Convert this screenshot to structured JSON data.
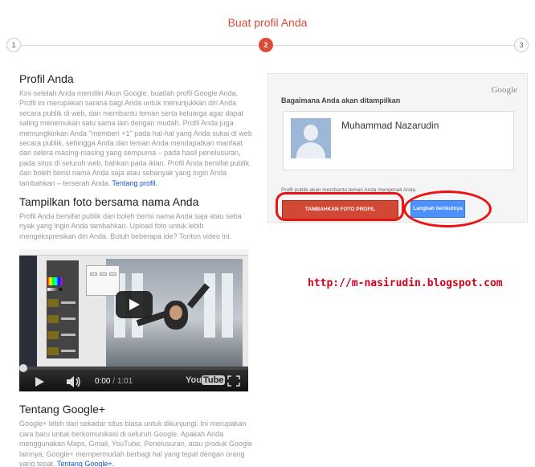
{
  "header": {
    "title": "Buat profil Anda"
  },
  "stepper": {
    "steps": [
      "1",
      "2",
      "3"
    ],
    "current": 2
  },
  "sections": [
    {
      "title": "Profil Anda",
      "text": "Kini setelah Anda memiliki Akun Google, buatlah profil Google Anda. Profil ini merupakan sarana bagi Anda untuk menunjukkan diri Anda secara publik di web, dan membantu teman serta keluarga agar dapat saling menemukan satu sama lain dengan mudah. Profil Anda juga memungkinkan Anda \"memberi +1\" pada hal-hal yang Anda sukai di web secara publik, sehingga Anda dan teman Anda mendapatkan manfaat dari selera masing-masing yang sempurna – pada hasil penelusuran, pada situs di seluruh web, bahkan pada iklan. Profil Anda bersifat publik dan boleh berisi nama Anda saja atau sebanyak yang ingin Anda tambahkan – terserah Anda. ",
      "link": "Tentang profil."
    },
    {
      "title": "Tampilkan foto bersama nama Anda",
      "text": "Profil Anda bersifat publik dan boleh berisi nama Anda saja atau seba nyak yang ingin Anda tambahkan. Upload foto untuk lebih mengekspresikan diri Anda. Butuh beberapa ide? Tonton video ini.",
      "link": ""
    },
    {
      "title": "Tentang Google+",
      "text": "Google+ lebih dari sekadar situs biasa untuk dikunjungi. Ini merupakan cara baru untuk berkomunikasi di seluruh Google. Apakah Anda menggunakan Maps, Gmail, YouTube, Penelusuran, atau produk Google lainnya, Google+ mempermudah berbagi hal yang tepat dengan orang yang tepat. ",
      "link": "Tentang Google+."
    }
  ],
  "video": {
    "current_time": "0:00",
    "separator": " / ",
    "duration": "1:01",
    "progress": 0.0,
    "logo_you": "You",
    "logo_tube": "Tube"
  },
  "card": {
    "google_logo": "Google",
    "heading": "Bagaimana Anda akan ditampilkan",
    "profile_name": "Muhammad Nazarudin",
    "note": "Profil publik akan membantu teman Anda mengenali Anda.",
    "add_photo_button": "TAMBAHKAN FOTO PROFIL",
    "next_button": "Langkah berikutnya"
  },
  "watermark": "http://m-nasirudin.blogspot.com",
  "colors": {
    "accent_red": "#dd4b39",
    "button_red": "#d14836",
    "button_blue": "#4d90fe",
    "link_blue": "#1155cc",
    "annotation_red": "#e11111",
    "watermark_red": "#d0021b"
  },
  "icons": [
    "play-icon",
    "volume-icon",
    "fullscreen-icon",
    "avatar-placeholder-icon"
  ]
}
